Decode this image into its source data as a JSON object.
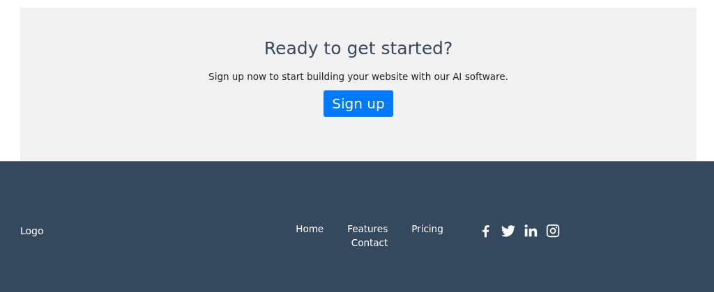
{
  "cta": {
    "title": "Ready to get started?",
    "text": "Sign up now to start building your website with our AI software.",
    "button": "Sign up"
  },
  "footer": {
    "logo": "Logo",
    "links": [
      "Home",
      "Features",
      "Pricing",
      "Contact"
    ]
  }
}
